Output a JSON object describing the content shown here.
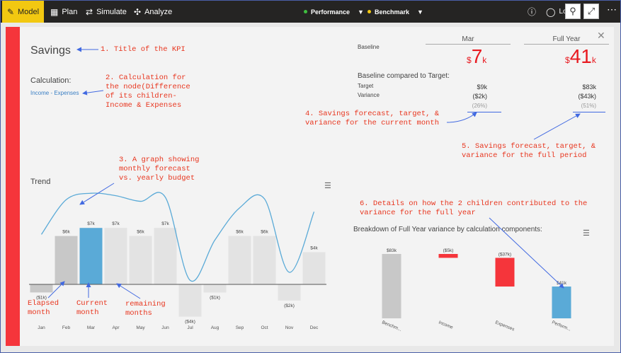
{
  "toolbar": {
    "model": "Model",
    "plan": "Plan",
    "simulate": "Simulate",
    "analyze": "Analyze",
    "performance": "Performance",
    "benchmark": "Benchmark",
    "login": "Lo",
    "colors": {
      "model_bg": "#f2c811",
      "performance_dot": "#3fbf3f",
      "benchmark_dot": "#f2c811"
    }
  },
  "kpi": {
    "title": "Savings",
    "calculation_label": "Calculation:",
    "calculation_formula": "Income - Expenses",
    "trend_label": "Trend",
    "col_mar": "Mar",
    "col_full_year": "Full Year",
    "baseline_label": "Baseline",
    "mar_value_currency": "$",
    "mar_value": "7",
    "mar_value_unit": "k",
    "fy_value_currency": "$",
    "fy_value": "41",
    "fy_value_unit": "k",
    "compare_title": "Baseline compared to Target:",
    "target_label": "Target",
    "variance_label": "Variance",
    "mar_target": "$9k",
    "mar_variance": "($2k)",
    "mar_variance_pct": "(26%)",
    "fy_target": "$83k",
    "fy_variance": "($43k)",
    "fy_variance_pct": "(51%)",
    "breakdown_title": "Breakdown of Full Year variance by calculation components:"
  },
  "annotations": {
    "a1": "1. Title of the KPI",
    "a2": "2. Calculation for\nthe node(Difference\nof its children-\nIncome & Expenses",
    "a3": "3. A graph showing\nmonthly forecast\nvs. yearly budget",
    "a4": "4. Savings forecast, target, &\nvariance for the current month",
    "a5": "5. Savings forecast, target, &\nvariance for the full period",
    "a6": "6. Details on how the 2 children contributed to the\nvariance for the full year",
    "elapsed": "Elapsed\nmonth",
    "current": "Current\nmonth",
    "remaining": "remaining\nmonths"
  },
  "chart_data": [
    {
      "type": "bar",
      "categories": [
        "Jan",
        "Feb",
        "Mar",
        "Apr",
        "May",
        "Jun",
        "Jul",
        "Aug",
        "Sep",
        "Oct",
        "Nov",
        "Dec"
      ],
      "values": [
        -1,
        6,
        7,
        7,
        6,
        7,
        -4,
        -1,
        6,
        6,
        -2,
        4
      ],
      "data_labels": [
        "($1k)",
        "$6k",
        "$7k",
        "$7k",
        "$6k",
        "$7k",
        "($4k)",
        "($1k)",
        "$6k",
        "$6k",
        "($2k)",
        "$4k"
      ],
      "month_status": [
        "elapsed",
        "elapsed",
        "current",
        "remaining",
        "remaining",
        "remaining",
        "remaining",
        "remaining",
        "remaining",
        "remaining",
        "remaining",
        "remaining"
      ],
      "budget_line": [
        6.2,
        10.5,
        11.3,
        11.0,
        10.3,
        10.8,
        0.5,
        5.5,
        9.5,
        10.6,
        1.5,
        9.0
      ],
      "colors": {
        "elapsed": "#c8c8c8",
        "current": "#5aaad7",
        "remaining": "#e3e3e3",
        "line": "#5aaad7"
      },
      "ylim": [
        -4.5,
        12
      ]
    },
    {
      "type": "bar",
      "subtype": "waterfall",
      "categories": [
        "Benchm...",
        "Income",
        "Expenses",
        "Perform..."
      ],
      "bars": [
        {
          "start": 0,
          "end": 83,
          "label": "$83k",
          "color": "#c8c8c8"
        },
        {
          "start": 83,
          "end": 78,
          "label": "($5k)",
          "color": "#f5353b"
        },
        {
          "start": 78,
          "end": 41,
          "label": "($37k)",
          "color": "#f5353b"
        },
        {
          "start": 0,
          "end": 41,
          "label": "$41k",
          "color": "#5aaad7"
        }
      ],
      "ylim": [
        0,
        90
      ]
    }
  ]
}
